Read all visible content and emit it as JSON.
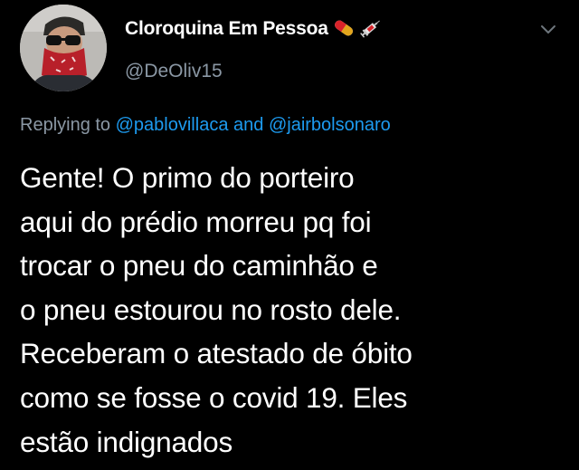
{
  "author": {
    "display_name": "Cloroquina Em Pessoa",
    "handle": "@DeOliv15",
    "name_emojis": [
      "pill-icon",
      "syringe-icon"
    ]
  },
  "reply": {
    "prefix": "Replying to",
    "mention_1": "@pablovillaca",
    "conjunction": "and",
    "mention_2": "@jairbolsonaro"
  },
  "tweet": {
    "lines": [
      "Gente! O primo do porteiro",
      "aqui do prédio morreu pq foi",
      "trocar o pneu do caminhão e",
      "o pneu estourou no rosto dele.",
      "Receberam o atestado de óbito",
      "como se fosse o covid 19. Eles",
      "estão indignados"
    ]
  },
  "colors": {
    "background": "#000000",
    "text": "#ffffff",
    "secondary": "#8b98a5",
    "mention": "#1d9bf0"
  },
  "icons": {
    "menu": "chevron-down-icon"
  }
}
